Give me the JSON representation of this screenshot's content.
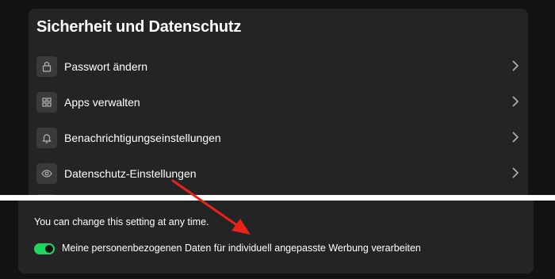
{
  "section": {
    "title": "Sicherheit und Datenschutz",
    "items": [
      {
        "label": "Passwort ändern",
        "icon": "lock-icon"
      },
      {
        "label": "Apps verwalten",
        "icon": "grid-icon"
      },
      {
        "label": "Benachrichtigungseinstellungen",
        "icon": "bell-icon"
      },
      {
        "label": "Datenschutz-Einstellungen",
        "icon": "eye-icon"
      }
    ]
  },
  "privacy": {
    "hint": "You can change this setting at any time.",
    "toggle_label": "Meine personenbezogenen Daten für individuell angepasste Werbung verarbeiten",
    "toggle_on": true
  },
  "colors": {
    "accent": "#1ed760",
    "arrow": "#e8231a",
    "card": "#242424",
    "background": "#121212"
  }
}
